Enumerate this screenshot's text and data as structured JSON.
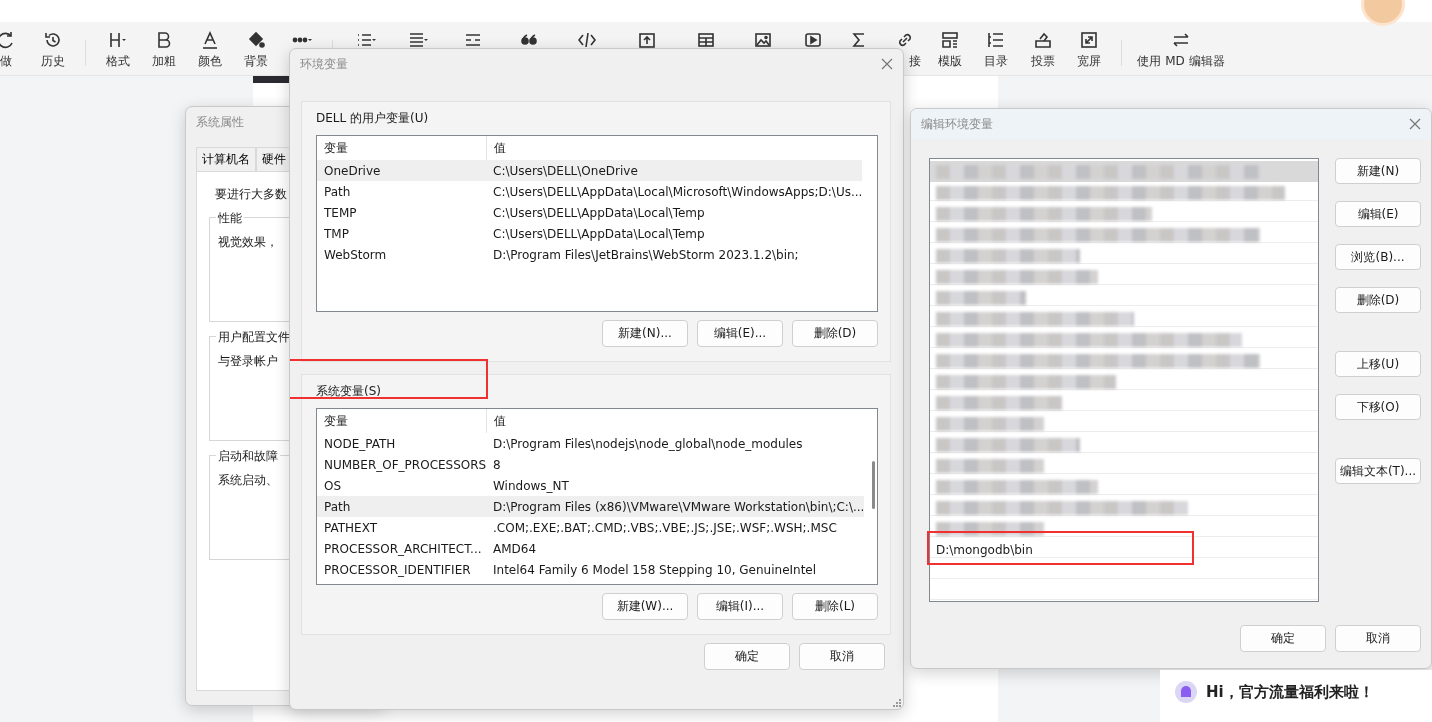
{
  "editor_toolbar": {
    "groups": [
      {
        "items": [
          {
            "kind": "redo",
            "label": "做"
          },
          {
            "kind": "history",
            "label": "历史"
          }
        ]
      },
      {
        "items": [
          {
            "kind": "heading",
            "label": "格式"
          },
          {
            "kind": "bold",
            "label": "加粗"
          },
          {
            "kind": "color",
            "label": "颜色"
          },
          {
            "kind": "fill",
            "label": "背景"
          },
          {
            "kind": "more"
          }
        ]
      },
      {
        "items": [
          {
            "kind": "list"
          },
          {
            "kind": "align"
          },
          {
            "kind": "rule"
          },
          {
            "kind": "quote"
          },
          {
            "kind": "code"
          },
          {
            "kind": "upload"
          },
          {
            "kind": "table"
          },
          {
            "kind": "image"
          },
          {
            "kind": "video"
          },
          {
            "kind": "formula"
          },
          {
            "kind": "link",
            "label": "接"
          },
          {
            "kind": "template",
            "label": "模版"
          },
          {
            "kind": "toc",
            "label": "目录"
          },
          {
            "kind": "vote",
            "label": "投票"
          },
          {
            "kind": "fullscreen",
            "label": "宽屏"
          }
        ]
      },
      {
        "items": [
          {
            "kind": "switch",
            "label": "使用 MD 编辑器"
          }
        ]
      }
    ]
  },
  "system_properties": {
    "title": "系统属性",
    "tabs": [
      {
        "label": "计算机名",
        "selected": false
      },
      {
        "label": "硬件",
        "selected": false
      }
    ],
    "intro": "要进行大多数",
    "groups": [
      {
        "title": "性能",
        "text": "视觉效果，"
      },
      {
        "title": "用户配置文件",
        "text": "与登录帐户"
      },
      {
        "title": "启动和故障",
        "text": "系统启动、"
      }
    ]
  },
  "environment_variables": {
    "title": "环境变量",
    "user_group": {
      "title": "DELL 的用户变量(U)",
      "highlighted": false,
      "columns": [
        "变量",
        "值"
      ],
      "rows": [
        {
          "name": "OneDrive",
          "value": "C:\\Users\\DELL\\OneDrive",
          "selected": true
        },
        {
          "name": "Path",
          "value": "C:\\Users\\DELL\\AppData\\Local\\Microsoft\\WindowsApps;D:\\Us...",
          "selected": false
        },
        {
          "name": "TEMP",
          "value": "C:\\Users\\DELL\\AppData\\Local\\Temp",
          "selected": false
        },
        {
          "name": "TMP",
          "value": "C:\\Users\\DELL\\AppData\\Local\\Temp",
          "selected": false
        },
        {
          "name": "WebStorm",
          "value": "D:\\Program Files\\JetBrains\\WebStorm 2023.1.2\\bin;",
          "selected": false
        }
      ],
      "buttons": [
        "新建(N)...",
        "编辑(E)...",
        "删除(D)"
      ]
    },
    "system_group": {
      "title": "系统变量(S)",
      "highlighted": true,
      "columns": [
        "变量",
        "值"
      ],
      "rows": [
        {
          "name": "NODE_PATH",
          "value": "D:\\Program Files\\nodejs\\node_global\\node_modules",
          "selected": false
        },
        {
          "name": "NUMBER_OF_PROCESSORS",
          "value": "8",
          "selected": false
        },
        {
          "name": "OS",
          "value": "Windows_NT",
          "selected": false
        },
        {
          "name": "Path",
          "value": "D:\\Program Files (x86)\\VMware\\VMware Workstation\\bin\\;C:\\...",
          "selected": true
        },
        {
          "name": "PATHEXT",
          "value": ".COM;.EXE;.BAT;.CMD;.VBS;.VBE;.JS;.JSE;.WSF;.WSH;.MSC",
          "selected": false
        },
        {
          "name": "PROCESSOR_ARCHITECT...",
          "value": "AMD64",
          "selected": false
        },
        {
          "name": "PROCESSOR_IDENTIFIER",
          "value": "Intel64 Family 6 Model 158 Stepping 10, GenuineIntel",
          "selected": false
        }
      ],
      "buttons": [
        "新建(W)...",
        "编辑(I)...",
        "删除(L)"
      ]
    },
    "footer_buttons": [
      "确定",
      "取消"
    ]
  },
  "edit_variable": {
    "title": "编辑环境变量",
    "entries": [
      {
        "kind": "blurred",
        "selected": true
      },
      {
        "kind": "blurred",
        "selected": false
      },
      {
        "kind": "blurred",
        "selected": false
      },
      {
        "kind": "blurred",
        "selected": false
      },
      {
        "kind": "blurred",
        "selected": false
      },
      {
        "kind": "blurred",
        "selected": false
      },
      {
        "kind": "blurred",
        "selected": false
      },
      {
        "kind": "blurred",
        "selected": false
      },
      {
        "kind": "blurred",
        "selected": false
      },
      {
        "kind": "blurred",
        "selected": false
      },
      {
        "kind": "blurred",
        "selected": false
      },
      {
        "kind": "blurred",
        "selected": false
      },
      {
        "kind": "blurred",
        "selected": false
      },
      {
        "kind": "blurred",
        "selected": false
      },
      {
        "kind": "blurred",
        "selected": false
      },
      {
        "kind": "blurred",
        "selected": false
      },
      {
        "kind": "blurred",
        "selected": false
      },
      {
        "kind": "blurred",
        "selected": false
      },
      {
        "kind": "text",
        "text": "D:\\mongodb\\bin",
        "selected": false,
        "highlighted": true
      }
    ],
    "side_buttons": [
      {
        "label": "新建(N)"
      },
      {
        "label": "编辑(E)"
      },
      {
        "label": "浏览(B)..."
      },
      {
        "label": "删除(D)",
        "gap_after": true
      },
      {
        "label": "上移(U)"
      },
      {
        "label": "下移(O)",
        "gap_after": true
      },
      {
        "label": "编辑文本(T)..."
      }
    ],
    "footer_buttons": [
      "确定",
      "取消"
    ]
  },
  "promo": {
    "title": "Hi，官方流量福利来啦！"
  }
}
